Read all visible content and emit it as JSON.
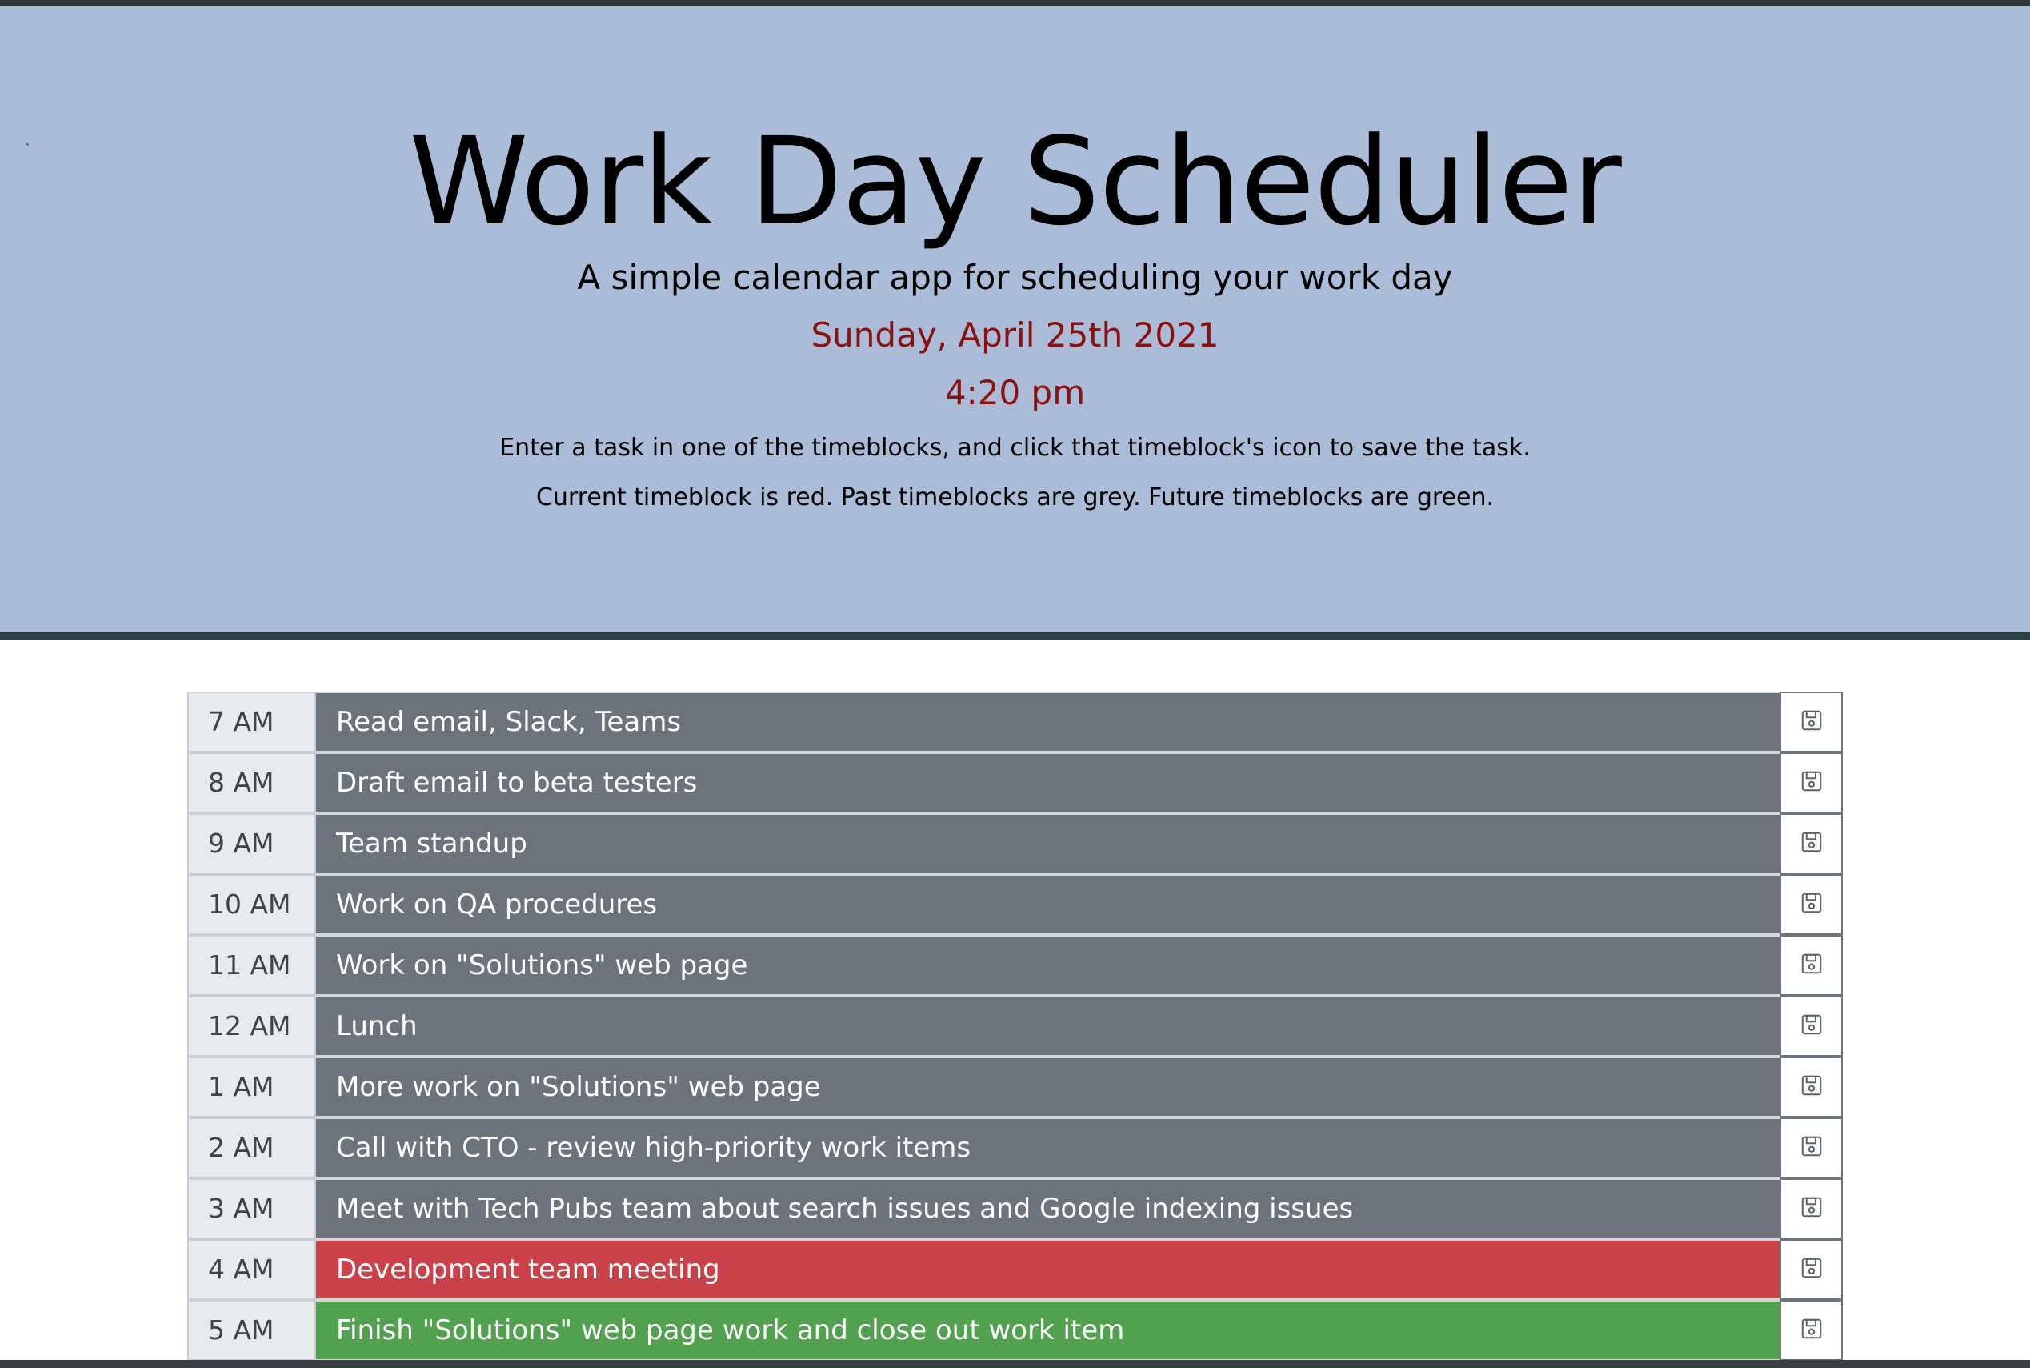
{
  "header": {
    "title": "Work Day Scheduler",
    "subtitle": "A simple calendar app for scheduling your work day",
    "date": "Sunday, April 25th 2021",
    "time": "4:20 pm",
    "instruction_1": "Enter a task in one of the timeblocks, and click that timeblock's icon to save the task.",
    "instruction_2": "Current timeblock is red. Past timeblocks are grey. Future timeblocks are green."
  },
  "colors": {
    "header_bg": "#aabcd7",
    "past": "#6d737b",
    "present": "#ca4149",
    "future": "#51a14f",
    "date_text": "#8b1111"
  },
  "timeblocks": [
    {
      "hour": "7 AM",
      "task": "Read email, Slack, Teams",
      "state": "past",
      "icon": "save-icon"
    },
    {
      "hour": "8 AM",
      "task": "Draft email to beta testers",
      "state": "past",
      "icon": "save-icon"
    },
    {
      "hour": "9 AM",
      "task": "Team standup",
      "state": "past",
      "icon": "save-icon"
    },
    {
      "hour": "10 AM",
      "task": "Work on QA procedures",
      "state": "past",
      "icon": "save-icon"
    },
    {
      "hour": "11 AM",
      "task": "Work on \"Solutions\" web page",
      "state": "past",
      "icon": "save-icon"
    },
    {
      "hour": "12 AM",
      "task": "Lunch",
      "state": "past",
      "icon": "save-icon"
    },
    {
      "hour": "1 AM",
      "task": "More work on \"Solutions\" web page",
      "state": "past",
      "icon": "save-icon"
    },
    {
      "hour": "2 AM",
      "task": "Call with CTO - review high-priority work items",
      "state": "past",
      "icon": "save-icon"
    },
    {
      "hour": "3 AM",
      "task": "Meet with Tech Pubs team about search issues and Google indexing issues",
      "state": "past",
      "icon": "save-icon"
    },
    {
      "hour": "4 AM",
      "task": "Development team meeting",
      "state": "present",
      "icon": "save-icon"
    },
    {
      "hour": "5 AM",
      "task": "Finish \"Solutions\" web page work and close out work item",
      "state": "future",
      "icon": "save-icon"
    }
  ]
}
